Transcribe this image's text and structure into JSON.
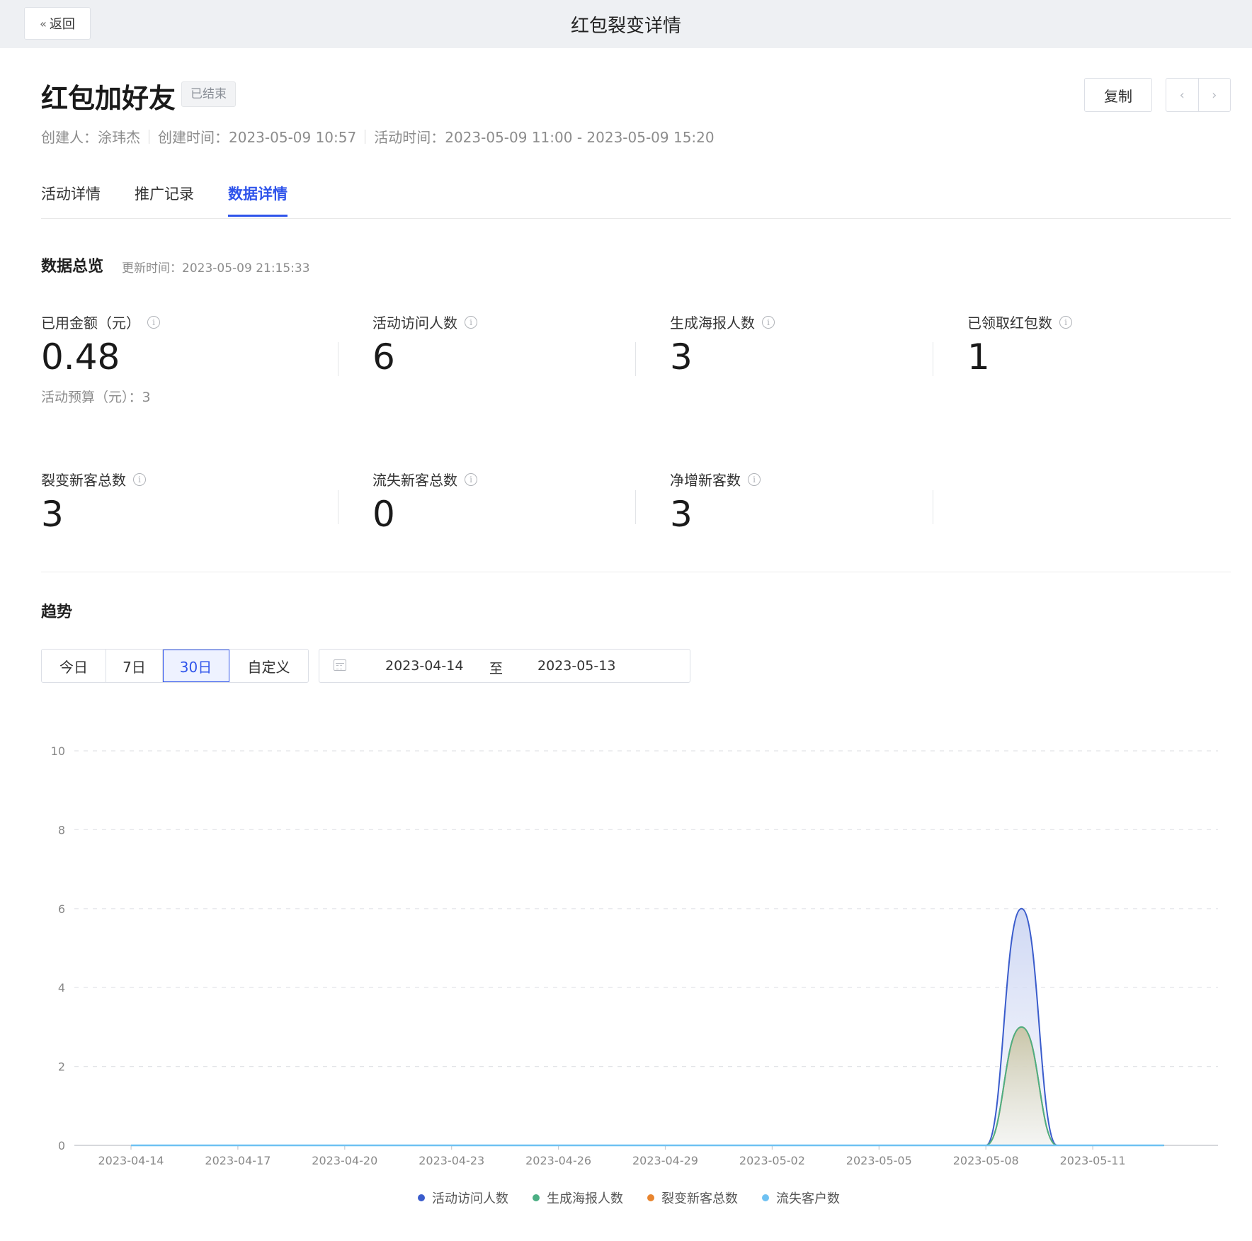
{
  "topbar": {
    "back_label": "返回",
    "title": "红包裂变详情"
  },
  "header": {
    "title": "红包加好友",
    "status": "已结束",
    "copy_label": "复制",
    "meta": {
      "creator": "创建人：涂玮杰",
      "created_at": "创建时间：2023-05-09 10:57",
      "activity_time": "活动时间：2023-05-09 11:00 - 2023-05-09 15:20"
    }
  },
  "tabs": [
    {
      "label": "活动详情",
      "active": false
    },
    {
      "label": "推广记录",
      "active": false
    },
    {
      "label": "数据详情",
      "active": true
    }
  ],
  "overview": {
    "title": "数据总览",
    "update_time": "更新时间：2023-05-09 21:15:33",
    "stats": [
      {
        "label": "已用金额（元）",
        "value": "0.48",
        "sub": "活动预算（元）：3"
      },
      {
        "label": "活动访问人数",
        "value": "6"
      },
      {
        "label": "生成海报人数",
        "value": "3"
      },
      {
        "label": "已领取红包数",
        "value": "1"
      },
      {
        "label": "裂变新客总数",
        "value": "3"
      },
      {
        "label": "流失新客总数",
        "value": "0"
      },
      {
        "label": "净增新客数",
        "value": "3"
      }
    ]
  },
  "trend": {
    "title": "趋势",
    "ranges": [
      {
        "label": "今日",
        "active": false
      },
      {
        "label": "7日",
        "active": false
      },
      {
        "label": "30日",
        "active": true
      },
      {
        "label": "自定义",
        "active": false
      }
    ],
    "date_start": "2023-04-14",
    "date_to": "至",
    "date_end": "2023-05-13"
  },
  "chart_data": {
    "type": "area",
    "x": [
      "2023-04-14",
      "2023-04-15",
      "2023-04-16",
      "2023-04-17",
      "2023-04-18",
      "2023-04-19",
      "2023-04-20",
      "2023-04-21",
      "2023-04-22",
      "2023-04-23",
      "2023-04-24",
      "2023-04-25",
      "2023-04-26",
      "2023-04-27",
      "2023-04-28",
      "2023-04-29",
      "2023-04-30",
      "2023-05-01",
      "2023-05-02",
      "2023-05-03",
      "2023-05-04",
      "2023-05-05",
      "2023-05-06",
      "2023-05-07",
      "2023-05-08",
      "2023-05-09",
      "2023-05-10",
      "2023-05-11",
      "2023-05-12",
      "2023-05-13"
    ],
    "x_tick_labels": [
      "2023-04-14",
      "2023-04-17",
      "2023-04-20",
      "2023-04-23",
      "2023-04-26",
      "2023-04-29",
      "2023-05-02",
      "2023-05-05",
      "2023-05-08",
      "2023-05-11"
    ],
    "ylim": [
      0,
      10
    ],
    "y_ticks": [
      0,
      2,
      4,
      6,
      8,
      10
    ],
    "grid": true,
    "legend_position": "bottom",
    "series": [
      {
        "name": "活动访问人数",
        "color": "#3a5ccc",
        "values": [
          0,
          0,
          0,
          0,
          0,
          0,
          0,
          0,
          0,
          0,
          0,
          0,
          0,
          0,
          0,
          0,
          0,
          0,
          0,
          0,
          0,
          0,
          0,
          0,
          0,
          6,
          0,
          0,
          0,
          0
        ]
      },
      {
        "name": "生成海报人数",
        "color": "#4caf84",
        "values": [
          0,
          0,
          0,
          0,
          0,
          0,
          0,
          0,
          0,
          0,
          0,
          0,
          0,
          0,
          0,
          0,
          0,
          0,
          0,
          0,
          0,
          0,
          0,
          0,
          0,
          3,
          0,
          0,
          0,
          0
        ]
      },
      {
        "name": "裂变新客总数",
        "color": "#e8852f",
        "values": [
          0,
          0,
          0,
          0,
          0,
          0,
          0,
          0,
          0,
          0,
          0,
          0,
          0,
          0,
          0,
          0,
          0,
          0,
          0,
          0,
          0,
          0,
          0,
          0,
          0,
          3,
          0,
          0,
          0,
          0
        ]
      },
      {
        "name": "流失客户数",
        "color": "#6ec1f2",
        "values": [
          0,
          0,
          0,
          0,
          0,
          0,
          0,
          0,
          0,
          0,
          0,
          0,
          0,
          0,
          0,
          0,
          0,
          0,
          0,
          0,
          0,
          0,
          0,
          0,
          0,
          0,
          0,
          0,
          0,
          0
        ]
      }
    ]
  }
}
